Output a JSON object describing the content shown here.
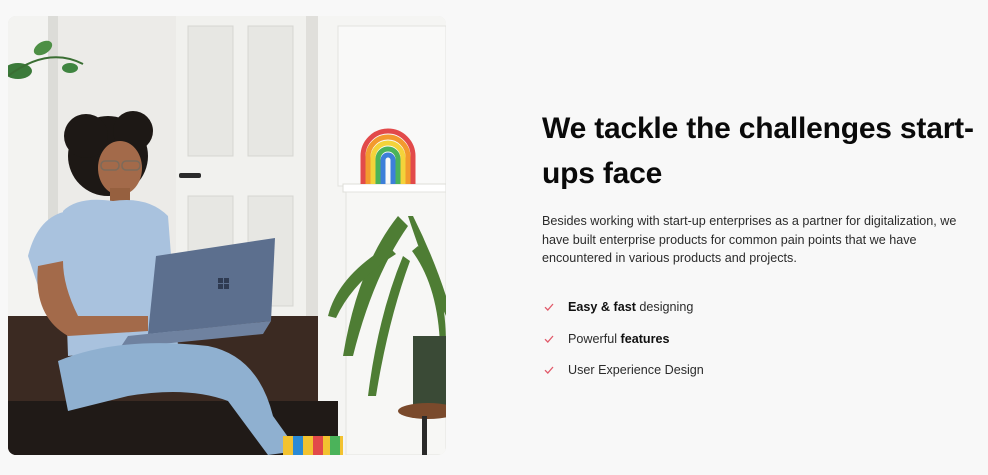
{
  "hero": {
    "image_alt": "Woman working on a laptop",
    "headline": "We tackle the challenges start-ups face",
    "description": "Besides working with start-up enterprises as a partner for digitalization, we have built enterprise products for common pain points that we have encountered in various products and projects.",
    "features": [
      {
        "bold": "Easy & fast",
        "rest": " designing",
        "icon": "check-icon"
      },
      {
        "pre": "Powerful ",
        "bold": "features",
        "icon": "check-icon"
      },
      {
        "pre": "User Experience Design",
        "icon": "check-icon"
      }
    ]
  },
  "colors": {
    "background": "#f8f8f8",
    "check_accent": "#e15a6a",
    "headline": "#0a0a0a"
  }
}
